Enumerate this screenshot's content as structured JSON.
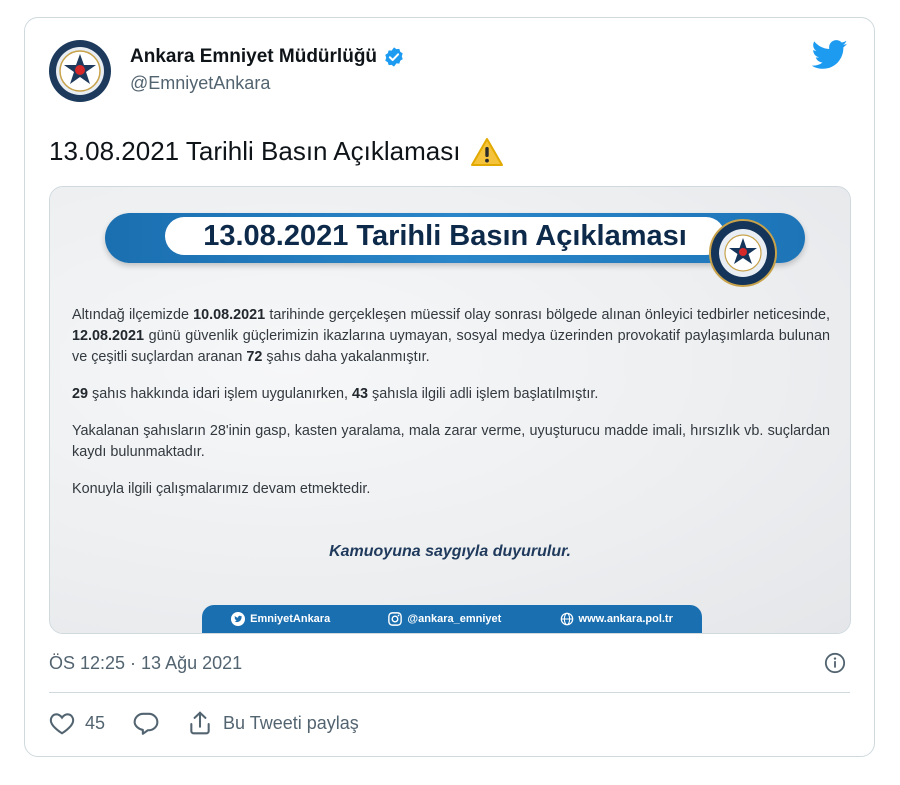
{
  "author": {
    "name": "Ankara Emniyet Müdürlüğü",
    "handle": "@EmniyetAnkara",
    "verified": true
  },
  "tweet": {
    "text": "13.08.2021 Tarihli Basın Açıklaması",
    "emoji": "⚠️"
  },
  "image": {
    "banner_title": "13.08.2021 Tarihli Basın Açıklaması",
    "paragraphs": [
      [
        "Altındağ ilçemizde ",
        {
          "b": "10.08.2021"
        },
        " tarihinde gerçekleşen müessif olay sonrası bölgede alınan önleyici tedbirler neticesinde, ",
        {
          "b": "12.08.2021"
        },
        " günü güvenlik güçlerimizin ikazlarına uymayan, sosyal medya üzerinden provokatif paylaşımlarda bulunan ve çeşitli suçlardan aranan ",
        {
          "b": "72"
        },
        " şahıs daha yakalanmıştır."
      ],
      [
        {
          "b": "29"
        },
        " şahıs hakkında idari işlem uygulanırken, ",
        {
          "b": "43"
        },
        " şahısla ilgili adli işlem başlatılmıştır."
      ],
      [
        "Yakalanan şahısların 28'inin gasp, kasten yaralama, mala zarar verme, uyuşturucu madde imali, hırsızlık vb. suçlardan kaydı bulunmaktadır."
      ],
      [
        "Konuyla ilgili çalışmalarımız devam etmektedir."
      ]
    ],
    "closing": "Kamuoyuna saygıyla duyurulur.",
    "footer": {
      "twitter": "EmniyetAnkara",
      "instagram": "@ankara_emniyet",
      "web": "www.ankara.pol.tr"
    }
  },
  "meta": {
    "timestamp": "ÖS 12:25 · 13 Ağu 2021"
  },
  "actions": {
    "like_count": "45",
    "share_label": "Bu Tweeti paylaş"
  },
  "colors": {
    "twitter_blue": "#1d9bf0",
    "banner_blue": "#1a6fb0",
    "navy": "#14345a"
  }
}
